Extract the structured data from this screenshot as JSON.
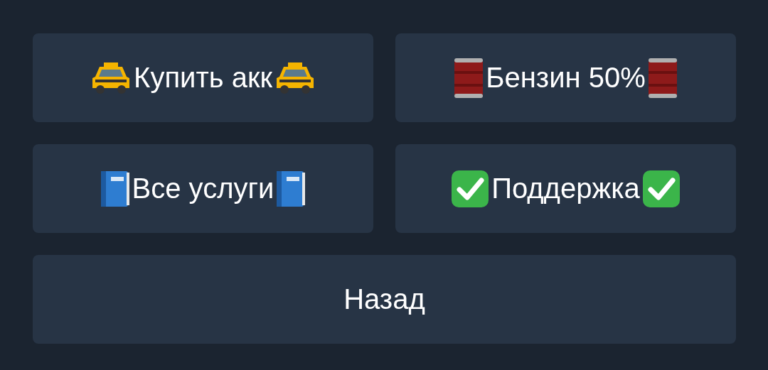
{
  "keyboard": {
    "buttons": [
      {
        "label": "Купить акк",
        "kind": "taxi",
        "wide": false
      },
      {
        "label": "Бензин 50%",
        "kind": "barrel",
        "wide": false
      },
      {
        "label": "Все услуги",
        "kind": "book",
        "wide": false
      },
      {
        "label": "Поддержка",
        "kind": "check",
        "wide": false
      },
      {
        "label": "Назад",
        "kind": "plain",
        "wide": true
      }
    ]
  }
}
